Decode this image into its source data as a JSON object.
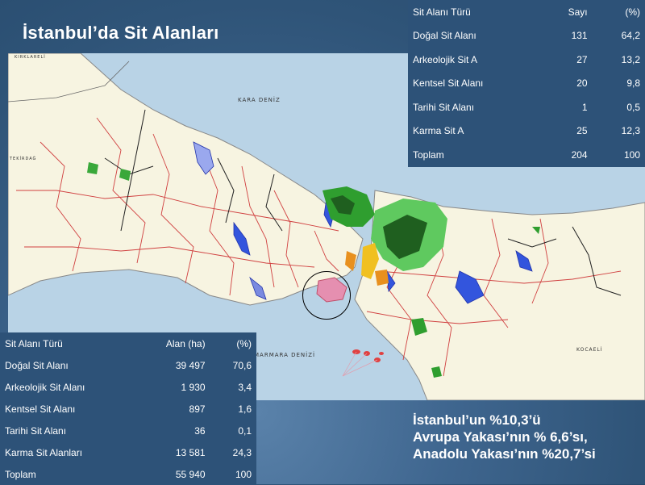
{
  "title": "İstanbul’da Sit Alanları",
  "map": {
    "labels": {
      "black_sea": "KARA DENİZ",
      "marmara": "MARMARA DENİZİ",
      "kirklareli": "KIRKLARELİ",
      "tekirdag": "TEKİRDAĞ",
      "kocaeli": "KOCAELİ"
    },
    "colors": {
      "sea": "#b9d3e6",
      "land": "#f7f4e1",
      "district_border": "#d04040",
      "natural_site": "#2f9e2f",
      "forest_site": "#1f5f1f",
      "urban_site": "#e58fb0",
      "reservoir": "#3355dd"
    }
  },
  "table_count": {
    "headers": [
      "Sit Alanı Türü",
      "Sayı",
      "(%)"
    ],
    "rows": [
      [
        "Doğal Sit Alanı",
        "131",
        "64,2"
      ],
      [
        "Arkeolojik Sit A",
        "27",
        "13,2"
      ],
      [
        "Kentsel Sit Alanı",
        "20",
        "9,8"
      ],
      [
        "Tarihi Sit Alanı",
        "1",
        "0,5"
      ],
      [
        "Karma Sit A",
        "25",
        "12,3"
      ],
      [
        "Toplam",
        "204",
        "100"
      ]
    ]
  },
  "table_area": {
    "headers": [
      "Sit Alanı Türü",
      "Alan (ha)",
      "(%)"
    ],
    "rows": [
      [
        "Doğal Sit Alanı",
        "39 497",
        "70,6"
      ],
      [
        "Arkeolojik Sit Alanı",
        "1 930",
        "3,4"
      ],
      [
        "Kentsel Sit Alanı",
        "897",
        "1,6"
      ],
      [
        "Tarihi Sit Alanı",
        "36",
        "0,1"
      ],
      [
        "Karma Sit Alanları",
        "13 581",
        "24,3"
      ],
      [
        "Toplam",
        "55 940",
        "100"
      ]
    ]
  },
  "note": {
    "line1": "İstanbul’un %10,3’ü",
    "line2": "Avrupa Yakası’nın % 6,6’sı,",
    "line3": "Anadolu Yakası’nın %20,7’si"
  }
}
